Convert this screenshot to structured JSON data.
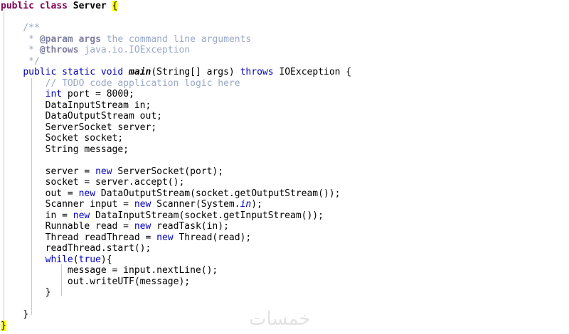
{
  "editor": {
    "lines": [
      {
        "parts": [
          [
            "kw",
            "public"
          ],
          [
            "",
            " "
          ],
          [
            "kw",
            "class"
          ],
          [
            "",
            " "
          ],
          [
            "bold",
            "Server"
          ],
          [
            "",
            " "
          ],
          [
            "bracket-hl",
            "{"
          ]
        ]
      },
      {
        "parts": [
          [
            "",
            ""
          ]
        ]
      },
      {
        "parts": [
          [
            "comment-light",
            "    /**"
          ]
        ]
      },
      {
        "parts": [
          [
            "comment-light",
            "     * "
          ],
          [
            "comment-tag",
            "@param"
          ],
          [
            "comment-light",
            " "
          ],
          [
            "comment-tag",
            "args"
          ],
          [
            "comment-light",
            " the command line arguments"
          ]
        ]
      },
      {
        "parts": [
          [
            "comment-light",
            "     * "
          ],
          [
            "comment-tag",
            "@throws"
          ],
          [
            "comment-light",
            " java.io.IOException"
          ]
        ]
      },
      {
        "parts": [
          [
            "comment-light",
            "     */"
          ]
        ]
      },
      {
        "parts": [
          [
            "",
            "    "
          ],
          [
            "kw-blue",
            "public"
          ],
          [
            "",
            " "
          ],
          [
            "kw-blue",
            "static"
          ],
          [
            "",
            " "
          ],
          [
            "kw-blue",
            "void"
          ],
          [
            "",
            " "
          ],
          [
            "italic-bold",
            "main"
          ],
          [
            "",
            "(String[] args) "
          ],
          [
            "kw-blue",
            "throws"
          ],
          [
            "",
            " IOException {"
          ]
        ]
      },
      {
        "parts": [
          [
            "",
            "        "
          ],
          [
            "line-comment",
            "// TODO code application logic here"
          ]
        ]
      },
      {
        "parts": [
          [
            "",
            "        "
          ],
          [
            "kw-blue",
            "int"
          ],
          [
            "",
            " port = 8000;"
          ]
        ]
      },
      {
        "parts": [
          [
            "",
            "        DataInputStream in;"
          ]
        ]
      },
      {
        "parts": [
          [
            "",
            "        DataOutputStream out;"
          ]
        ]
      },
      {
        "parts": [
          [
            "",
            "        ServerSocket server;"
          ]
        ]
      },
      {
        "parts": [
          [
            "",
            "        Socket socket;"
          ]
        ]
      },
      {
        "parts": [
          [
            "",
            "        String message;"
          ]
        ]
      },
      {
        "parts": [
          [
            "",
            ""
          ]
        ]
      },
      {
        "parts": [
          [
            "",
            "        server = "
          ],
          [
            "kw-blue",
            "new"
          ],
          [
            "",
            " ServerSocket(port);"
          ]
        ]
      },
      {
        "parts": [
          [
            "",
            "        socket = server.accept();"
          ]
        ]
      },
      {
        "parts": [
          [
            "",
            "        out = "
          ],
          [
            "kw-blue",
            "new"
          ],
          [
            "",
            " DataOutputStream(socket.getOutputStream());"
          ]
        ]
      },
      {
        "parts": [
          [
            "",
            "        Scanner input = "
          ],
          [
            "kw-blue",
            "new"
          ],
          [
            "",
            " Scanner(System."
          ],
          [
            "static-field",
            "in"
          ],
          [
            "",
            ");"
          ]
        ]
      },
      {
        "parts": [
          [
            "",
            "        in = "
          ],
          [
            "kw-blue",
            "new"
          ],
          [
            "",
            " DataInputStream(socket.getInputStream());"
          ]
        ]
      },
      {
        "parts": [
          [
            "",
            "        Runnable read = "
          ],
          [
            "kw-blue",
            "new"
          ],
          [
            "",
            " readTask(in);"
          ]
        ]
      },
      {
        "parts": [
          [
            "",
            "        Thread readThread = "
          ],
          [
            "kw-blue",
            "new"
          ],
          [
            "",
            " Thread(read);"
          ]
        ]
      },
      {
        "parts": [
          [
            "",
            "        readThread.start();"
          ]
        ]
      },
      {
        "parts": [
          [
            "",
            "        "
          ],
          [
            "kw-blue",
            "while"
          ],
          [
            "",
            "("
          ],
          [
            "kw-blue",
            "true"
          ],
          [
            "",
            "){"
          ]
        ]
      },
      {
        "parts": [
          [
            "",
            "            message = input.nextLine();"
          ]
        ]
      },
      {
        "parts": [
          [
            "",
            "            out.writeUTF(message);"
          ]
        ]
      },
      {
        "parts": [
          [
            "",
            "        }"
          ]
        ]
      },
      {
        "parts": [
          [
            "",
            ""
          ]
        ]
      },
      {
        "parts": [
          [
            "",
            "    }"
          ]
        ]
      },
      {
        "parts": [
          [
            "bracket-hl",
            "}"
          ]
        ]
      }
    ]
  },
  "watermark": {
    "text": "خمسات"
  },
  "colors": {
    "keyword": "#7f0055",
    "keyword_blue": "#0000c0",
    "comment": "#9aa8c8",
    "bracket_highlight": "#ffff00",
    "background": "#ffffff"
  }
}
